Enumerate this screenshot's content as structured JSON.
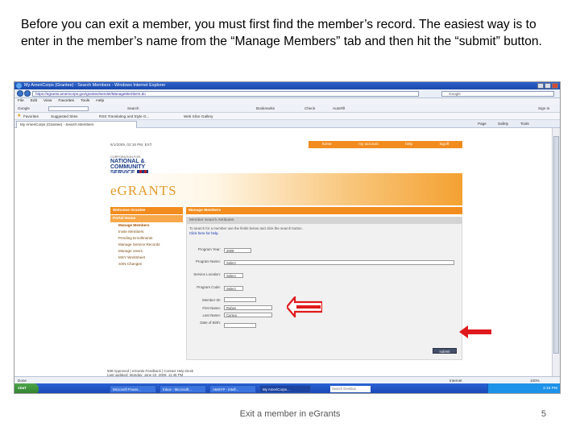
{
  "instructions": "Before you can exit a member, you must first find the member’s record.  The easiest way is to enter in the member’s name from the “Manage Members” tab and then hit the “submit” button.",
  "browser": {
    "title": "My AmeriCorps (Grantee) - Search Members - Windows Internet Explorer",
    "url": "https://egrants.americorps.gov/grantee/servlet/ManageMembers.do",
    "search_placeholder": "Google",
    "menu": [
      "File",
      "Edit",
      "View",
      "Favorites",
      "Tools",
      "Help"
    ],
    "google_label": "Google",
    "toolbar_items": [
      "Search",
      "Bookmarks",
      "Check",
      "AutoFill",
      "Sign In"
    ],
    "favorites_label": "Favorites",
    "favorites_items": [
      "Suggested Sites",
      "RSS Translating and Style G...",
      "Web Slice Gallery"
    ],
    "tab_label": "My AmeriCorps (Grantee) - Search Members",
    "command_items": [
      "Page",
      "Safety",
      "Tools"
    ]
  },
  "page": {
    "datetime": "6/1/2009, 02:16 PM, EST",
    "topnav": [
      "home",
      "my account",
      "help",
      "logoff"
    ],
    "logo_small": "CORPORATION FOR",
    "logo_lines": [
      "NATIONAL &",
      "COMMUNITY",
      "SERVICE"
    ],
    "brand": "eGRANTS",
    "sidebar": {
      "welcome": "Welcome Grantee",
      "portal": "Portal Home",
      "items": [
        "Manage Members",
        "Invite Members",
        "Pending Enrollments",
        "Manage Service Records",
        "Manage Users",
        "MSY Worksheet",
        "SSN Changes"
      ]
    },
    "main_title": "Manage Members",
    "panel_title": "Member Search Attributes",
    "panel_text": "To search for a member use the fields below and click the search button.",
    "panel_link": "Click here for help.",
    "fields": [
      {
        "label": "Program Year:",
        "value": "2009"
      },
      {
        "label": "Program Name:",
        "value": "Select"
      },
      {
        "label": "Service Location:",
        "value": "Select"
      },
      {
        "label": "Program Code:",
        "value": "Select"
      },
      {
        "label": "Member ID:",
        "value": ""
      },
      {
        "label": "First Name:",
        "value": "Ruben"
      },
      {
        "label": "Last Name:",
        "value": "Correa"
      },
      {
        "label": "Date of Birth:",
        "value": ""
      }
    ],
    "submit_label": "submit",
    "footer": "508 Approved | eGrants Feedback | Contact Help Desk",
    "footer_updated": "Last updated: Monday, June 22, 2009, 11:45 PM"
  },
  "status": {
    "left": "Done",
    "zone": "Internet",
    "zoom": "100%"
  },
  "taskbar": {
    "start": "start",
    "tasks": [
      "Microsoft Power...",
      "Inbox - Microsoft...",
      "AMSYP - Intell...",
      "My AmeriCorps..."
    ],
    "search": "Search Desktop",
    "time": "2:16 PM"
  },
  "slide": {
    "footer": "Exit a member in eGrants",
    "page_number": "5"
  },
  "colors": {
    "accent": "#f28c1e",
    "arrow": "#e0191c"
  }
}
